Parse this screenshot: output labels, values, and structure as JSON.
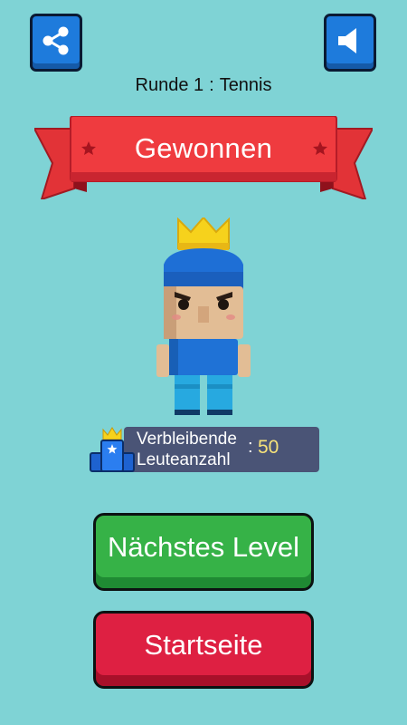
{
  "round": {
    "prefix": "Runde 1",
    "separator": ":",
    "mode": "Tennis"
  },
  "banner": {
    "title": "Gewonnen"
  },
  "remaining": {
    "label_line1": "Verbleibende",
    "label_line2": "Leuteanzahl",
    "colon": ":",
    "value": "50"
  },
  "buttons": {
    "next_label": "Nächstes Level",
    "home_label": "Startseite"
  },
  "icons": {
    "share": "share-icon",
    "sound": "speaker-icon",
    "crown": "crown-icon",
    "podium": "podium-icon",
    "star": "star-icon"
  },
  "colors": {
    "background": "#7fd3d5",
    "icon_button": "#1e7bdc",
    "banner": "#ef3b3f",
    "next_button": "#36b247",
    "home_button": "#de2042",
    "panel": "#4a5476",
    "value": "#f6e27a"
  }
}
